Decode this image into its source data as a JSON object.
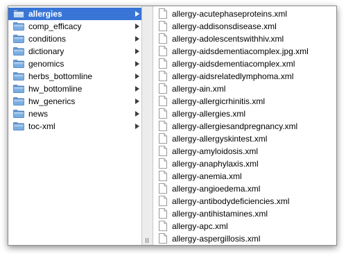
{
  "folders": [
    {
      "label": "allergies",
      "selected": true
    },
    {
      "label": "comp_efficacy",
      "selected": false
    },
    {
      "label": "conditions",
      "selected": false
    },
    {
      "label": "dictionary",
      "selected": false
    },
    {
      "label": "genomics",
      "selected": false
    },
    {
      "label": "herbs_bottomline",
      "selected": false
    },
    {
      "label": "hw_bottomline",
      "selected": false
    },
    {
      "label": "hw_generics",
      "selected": false
    },
    {
      "label": "news",
      "selected": false
    },
    {
      "label": "toc-xml",
      "selected": false
    }
  ],
  "files": [
    "allergy-acutephaseproteins.xml",
    "allergy-addisonsdisease.xml",
    "allergy-adolescentswithhiv.xml",
    "allergy-aidsdementiacomplex.jpg.xml",
    "allergy-aidsdementiacomplex.xml",
    "allergy-aidsrelatedlymphoma.xml",
    "allergy-ain.xml",
    "allergy-allergicrhinitis.xml",
    "allergy-allergies.xml",
    "allergy-allergiesandpregnancy.xml",
    "allergy-allergyskintest.xml",
    "allergy-amyloidosis.xml",
    "allergy-anaphylaxis.xml",
    "allergy-anemia.xml",
    "allergy-angioedema.xml",
    "allergy-antibodydeficiencies.xml",
    "allergy-antihistamines.xml",
    "allergy-apc.xml",
    "allergy-aspergillosis.xml"
  ],
  "icons": {
    "folder": "folder-icon",
    "document": "document-icon",
    "disclosure": "chevron-right-icon",
    "resize": "column-resize-handle-icon"
  },
  "colors": {
    "selection": "#3875d7",
    "folder_fill": "#7aaee3",
    "folder_edge": "#3f72b5"
  }
}
